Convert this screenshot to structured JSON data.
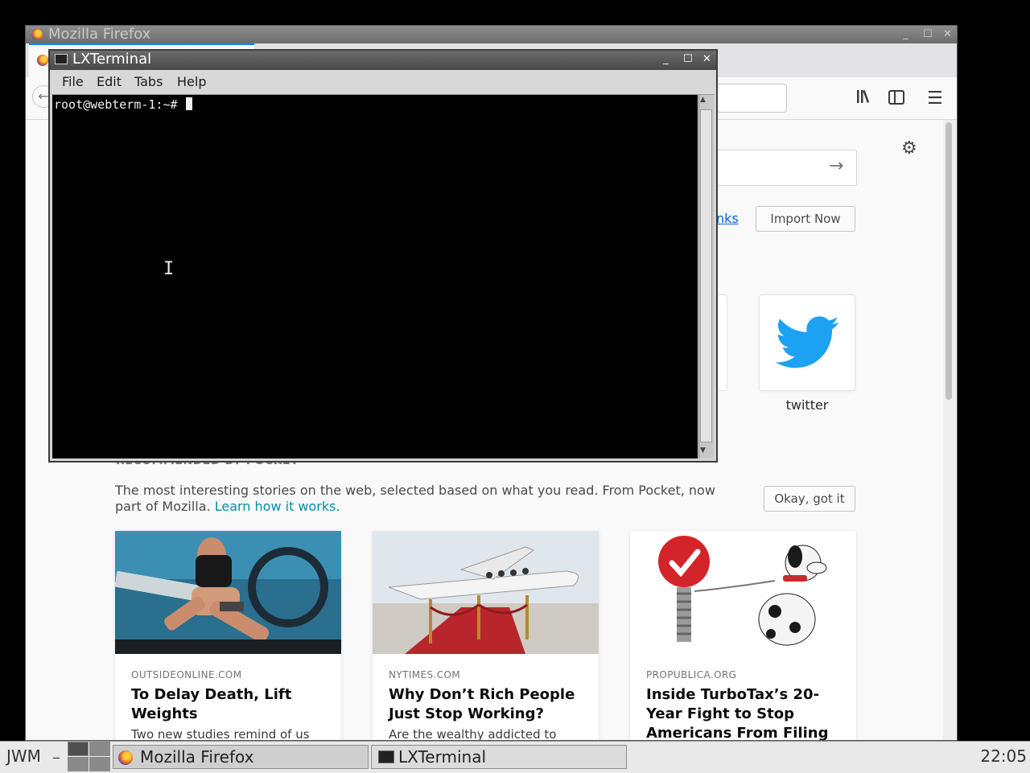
{
  "firefox": {
    "window_title": "Mozilla Firefox",
    "import_button": "Import Now",
    "bookmarks_link_partial": "nks",
    "top_site": {
      "label": "twitter"
    },
    "pocket": {
      "heading": "RECOMMENDED BY POCKET",
      "description": "The most interesting stories on the web, selected based on what you read. From Pocket, now part of Mozilla.",
      "learn_link": "Learn how it works.",
      "okay_button": "Okay, got it"
    },
    "cards": [
      {
        "source": "OUTSIDEONLINE.COM",
        "title": "To Delay Death, Lift Weights",
        "excerpt": "Two new studies remind of us"
      },
      {
        "source": "NYTIMES.COM",
        "title": "Why Don’t Rich People Just Stop Working?",
        "excerpt": "Are the wealthy addicted to"
      },
      {
        "source": "PROPUBLICA.ORG",
        "title": "Inside TurboTax’s 20-Year Fight to Stop Americans From Filing",
        "excerpt": ""
      }
    ]
  },
  "terminal": {
    "window_title": "LXTerminal",
    "menu": [
      "File",
      "Edit",
      "Tabs",
      "Help"
    ],
    "prompt": "root@webterm-1:~# "
  },
  "taskbar": {
    "wm_label": "JWM",
    "tasks": [
      "Mozilla Firefox",
      "LXTerminal"
    ],
    "clock": "22:05"
  }
}
